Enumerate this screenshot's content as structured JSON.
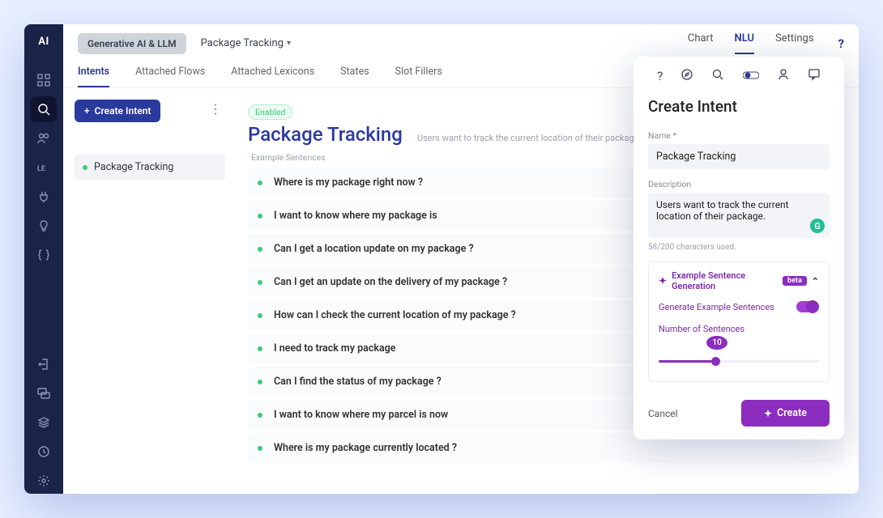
{
  "logo": "AI",
  "pill": "Generative AI & LLM",
  "breadcrumb": "Package Tracking",
  "topnav": {
    "chart": "Chart",
    "nlu": "NLU",
    "settings": "Settings"
  },
  "help": "?",
  "subtabs": {
    "intents": "Intents",
    "flows": "Attached Flows",
    "lexicons": "Attached Lexicons",
    "states": "States",
    "slot": "Slot Fillers"
  },
  "left": {
    "create": "Create Intent",
    "item": "Package Tracking"
  },
  "detail": {
    "enabled": "Enabled",
    "title": "Package Tracking",
    "subtitle": "Users want to track the current location of their package.",
    "example_label": "Example Sentences",
    "sentences": [
      "Where is my package right now ?",
      "I want to know where my package is",
      "Can I get a location update on my package ?",
      "Can I get an update on the delivery of my package ?",
      "How can I check the current location of my package ?",
      "I need to track my package",
      "Can I find the status of my package ?",
      "I want to know where my parcel is now",
      "Where is my package currently located ?"
    ]
  },
  "panel": {
    "title": "Create Intent",
    "name_label": "Name *",
    "name_value": "Package Tracking",
    "desc_label": "Description",
    "desc_value": "Users want to track the current location of their package.",
    "char_count": "58/200 characters used.",
    "gen_header": "Example Sentence Generation",
    "beta": "beta",
    "gen_toggle_label": "Generate Example Sentences",
    "num_label": "Number of Sentences",
    "num_value": "10",
    "cancel": "Cancel",
    "create": "Create"
  }
}
